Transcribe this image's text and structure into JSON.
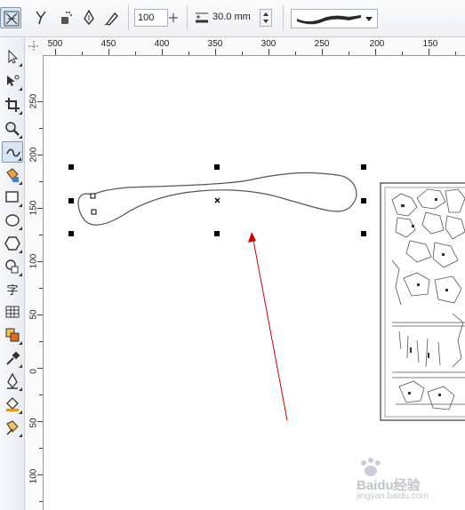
{
  "property_bar": {
    "tools": [
      {
        "name": "freehand-mode-icon",
        "active": true
      },
      {
        "name": "pen-preset-icon",
        "active": false
      },
      {
        "name": "spray-brush-icon",
        "active": false
      },
      {
        "name": "calligraphic-pen-icon",
        "active": false
      },
      {
        "name": "pressure-pen-icon",
        "active": false
      }
    ],
    "smoothing_value": "100",
    "width_value": "30.0 mm",
    "brush_stroke_icon": "brush-stroke-preview"
  },
  "ruler": {
    "horizontal_labels": [
      "500",
      "450",
      "400",
      "350",
      "300",
      "250",
      "200",
      "150"
    ],
    "vertical_labels": [
      "250",
      "200",
      "150",
      "100",
      "50",
      "0",
      "50",
      "100"
    ]
  },
  "toolbox": {
    "tools": [
      {
        "name": "pick-tool-icon",
        "active": false
      },
      {
        "name": "shape-tool-icon",
        "active": false
      },
      {
        "name": "crop-tool-icon",
        "active": false
      },
      {
        "name": "zoom-tool-icon",
        "active": false
      },
      {
        "name": "freehand-tool-icon",
        "active": true
      },
      {
        "name": "smart-fill-tool-icon",
        "active": false
      },
      {
        "name": "rectangle-tool-icon",
        "active": false
      },
      {
        "name": "ellipse-tool-icon",
        "active": false
      },
      {
        "name": "polygon-tool-icon",
        "active": false
      },
      {
        "name": "basic-shapes-tool-icon",
        "active": false
      },
      {
        "name": "text-tool-icon",
        "active": false,
        "glyph": "字"
      },
      {
        "name": "table-tool-icon",
        "active": false
      },
      {
        "name": "interactive-fill-tool-icon",
        "active": false
      },
      {
        "name": "eyedropper-tool-icon",
        "active": false
      },
      {
        "name": "outline-pen-tool-icon",
        "active": false
      },
      {
        "name": "fill-tool-icon",
        "active": false
      },
      {
        "name": "mesh-fill-tool-icon",
        "active": false
      }
    ]
  },
  "watermark": {
    "text": "Baidu经验",
    "subtext": "jingyan.baidu.com"
  },
  "colors": {
    "selection_handle": "#000000",
    "annotation_arrow": "#cc0000",
    "curve": "#555555",
    "page_background": "#ffffff"
  }
}
